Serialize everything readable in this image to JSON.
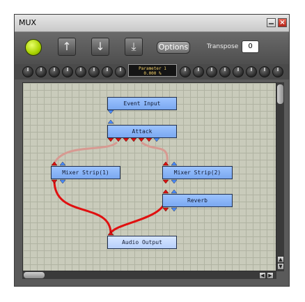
{
  "window": {
    "title": "MUX"
  },
  "toolbar": {
    "options_label": "Options",
    "transpose_label": "Transpose",
    "transpose_value": "0",
    "led_color": "#a9d200"
  },
  "parameter": {
    "name": "Parameter 1",
    "value": "0.000 %"
  },
  "graph": {
    "nodes": [
      {
        "id": "event-input",
        "label": "Event Input"
      },
      {
        "id": "attack",
        "label": "Attack"
      },
      {
        "id": "mixer-strip-1",
        "label": "Mixer Strip(1)"
      },
      {
        "id": "mixer-strip-2",
        "label": "Mixer Strip(2)"
      },
      {
        "id": "reverb",
        "label": "Reverb"
      },
      {
        "id": "audio-output",
        "label": "Audio Output"
      }
    ]
  }
}
